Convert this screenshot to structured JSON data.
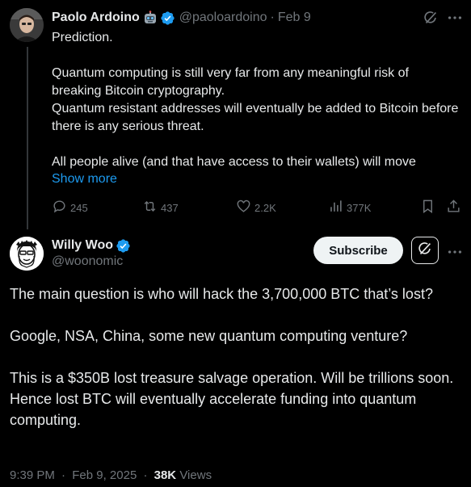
{
  "parent_tweet": {
    "author_name": "Paolo Ardoino",
    "author_badge_icon": "robot-emoji",
    "handle": "@paoloardoino",
    "separator": "·",
    "date": "Feb 9",
    "text": "Prediction.\n\nQuantum computing is still very far from any meaningful risk of breaking Bitcoin cryptography.\nQuantum resistant addresses will eventually be added to Bitcoin before there is any serious threat.\n\nAll people alive (and that have access to their wallets) will move",
    "show_more": "Show more",
    "actions": {
      "replies": "245",
      "reposts": "437",
      "likes": "2.2K",
      "views": "377K"
    }
  },
  "main_tweet": {
    "author_name": "Willy Woo",
    "handle": "@woonomic",
    "subscribe_label": "Subscribe",
    "text": "The main question is who will hack the 3,700,000 BTC that’s lost?\n\nGoogle, NSA, China, some new quantum computing venture?\n\nThis is a $350B lost treasure salvage operation. Will be trillions soon. Hence lost BTC will eventually accelerate funding into quantum computing.",
    "time": "9:39 PM",
    "separator": "·",
    "date": "Feb 9, 2025",
    "views_count": "38K",
    "views_label": "Views"
  },
  "colors": {
    "background": "#000000",
    "text_primary": "#e7e9ea",
    "text_secondary": "#71767b",
    "link_blue": "#1d9bf0",
    "verified_blue": "#1d9bf0",
    "thread_line": "#333639",
    "subscribe_bg": "#eff3f4"
  }
}
